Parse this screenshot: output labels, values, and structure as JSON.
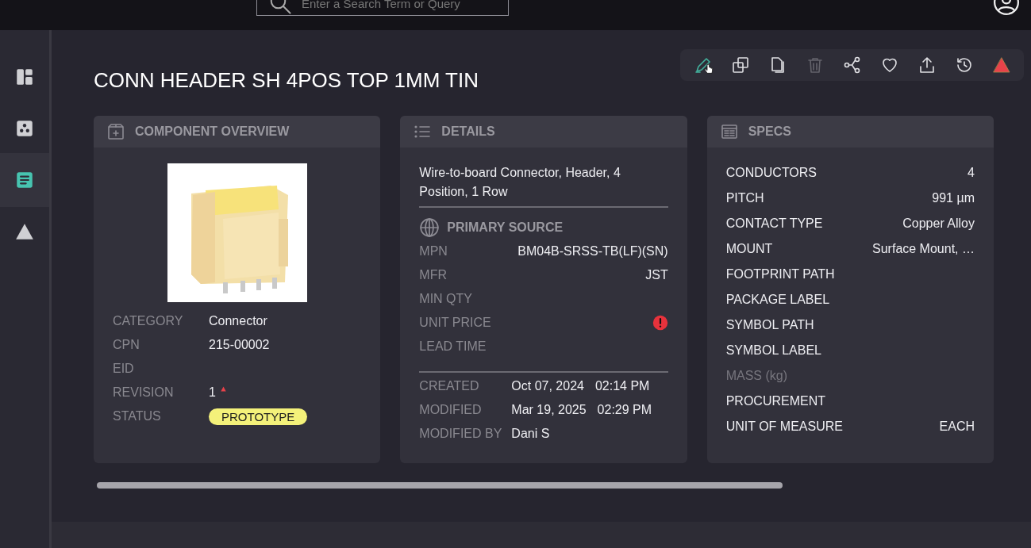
{
  "topbar": {
    "search": {
      "placeholder": "Enter a Search Term or Query"
    }
  },
  "sidebar": {
    "items": [
      {
        "kind": "dashboard",
        "selected": false
      },
      {
        "kind": "components",
        "selected": false
      },
      {
        "kind": "document",
        "selected": true
      },
      {
        "kind": "triangle",
        "selected": false
      }
    ]
  },
  "title": "CONN HEADER SH 4POS TOP 1MM TIN",
  "toolbar": {
    "buttons": [
      {
        "kind": "edit",
        "disabled": false
      },
      {
        "kind": "duplicate",
        "disabled": false
      },
      {
        "kind": "copy",
        "disabled": false
      },
      {
        "kind": "delete",
        "disabled": true
      },
      {
        "kind": "share",
        "disabled": false
      },
      {
        "kind": "favorite",
        "disabled": false
      },
      {
        "kind": "export",
        "disabled": false
      },
      {
        "kind": "history",
        "disabled": false
      },
      {
        "kind": "warning",
        "disabled": false
      }
    ]
  },
  "overview": {
    "heading": "COMPONENT OVERVIEW",
    "fields": [
      {
        "label": "CATEGORY",
        "value": "Connector",
        "warning": false
      },
      {
        "label": "CPN",
        "value": "215-00002",
        "warning": false
      },
      {
        "label": "EID",
        "warning": false
      },
      {
        "label": "REVISION",
        "value": "1",
        "warning": true
      },
      {
        "label": "STATUS",
        "badge": "PROTOTYPE",
        "warning": false
      }
    ]
  },
  "details": {
    "heading": "DETAILS",
    "description": "Wire-to-board Connector, Header, 4 Position, 1 Row",
    "source": {
      "heading": "PRIMARY SOURCE",
      "fields": [
        {
          "label": "MPN",
          "value": "BM04B-SRSS-TB(LF)(SN)",
          "alert": false
        },
        {
          "label": "MFR",
          "value": "JST",
          "alert": false
        },
        {
          "label": "MIN QTY",
          "alert": false
        },
        {
          "label": "UNIT PRICE",
          "alert": true
        },
        {
          "label": "LEAD TIME",
          "alert": false
        }
      ]
    },
    "history": [
      {
        "label": "CREATED",
        "date": "Oct 07, 2024",
        "time": "02:14 PM"
      },
      {
        "label": "MODIFIED",
        "date": "Mar 19, 2025",
        "time": "02:29 PM"
      },
      {
        "label": "MODIFIED BY",
        "value": "Dani S"
      }
    ]
  },
  "specs": {
    "heading": "SPECS",
    "rows": [
      {
        "label": "CONDUCTORS",
        "value": "4",
        "disabled": false
      },
      {
        "label": "PITCH",
        "value": "991 µm",
        "disabled": false
      },
      {
        "label": "CONTACT TYPE",
        "value": "Copper Alloy",
        "disabled": false
      },
      {
        "label": "MOUNT",
        "value": "Surface Mount, …",
        "disabled": false
      },
      {
        "label": "FOOTPRINT PATH",
        "disabled": false
      },
      {
        "label": "PACKAGE LABEL",
        "disabled": false
      },
      {
        "label": "SYMBOL PATH",
        "disabled": false
      },
      {
        "label": "SYMBOL LABEL",
        "disabled": false
      },
      {
        "label": "MASS (kg)",
        "disabled": true
      },
      {
        "label": "PROCUREMENT",
        "disabled": false
      },
      {
        "label": "UNIT OF MEASURE",
        "value": "EACH",
        "disabled": false
      }
    ]
  }
}
